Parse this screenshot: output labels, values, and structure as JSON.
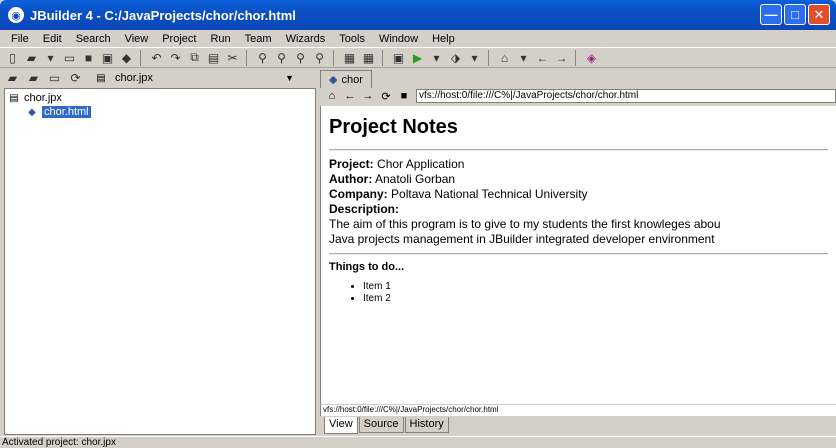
{
  "window": {
    "title": "JBuilder 4 - C:/JavaProjects/chor/chor.html",
    "minimize": "—",
    "maximize": "□",
    "close": "✕"
  },
  "menu": [
    "File",
    "Edit",
    "Search",
    "View",
    "Project",
    "Run",
    "Team",
    "Wizards",
    "Tools",
    "Window",
    "Help"
  ],
  "project_combo": {
    "value": "chor.jpx"
  },
  "tree": {
    "root": "chor.jpx",
    "child": "chor.html"
  },
  "editor_tab": {
    "label": "chor"
  },
  "url": "vfs://host:0/file:///C%|/JavaProjects/chor/chor.html",
  "doc": {
    "title": "Project Notes",
    "project_label": "Project:",
    "project_value": "Chor Application",
    "author_label": "Author:",
    "author_value": "Anatoli Gorban",
    "company_label": "Company:",
    "company_value": "Poltava National Technical University",
    "description_label": "Description:",
    "description_line1": "The aim of this program is to give to my students the first knowleges abou",
    "description_line2": "Java projects management in JBuilder integrated developer environment",
    "todo_title": "Things to do...",
    "items": [
      "Item 1",
      "Item 2"
    ]
  },
  "status_url": "vfs://host:0/file:///C%|/JavaProjects/chor/chor.html",
  "view_tabs": [
    "View",
    "Source",
    "History"
  ],
  "status": "Activated project: chor.jpx",
  "colors": {
    "title_bar": "#0b46b8",
    "selection": "#316ac5",
    "face": "#d4d0c8"
  }
}
